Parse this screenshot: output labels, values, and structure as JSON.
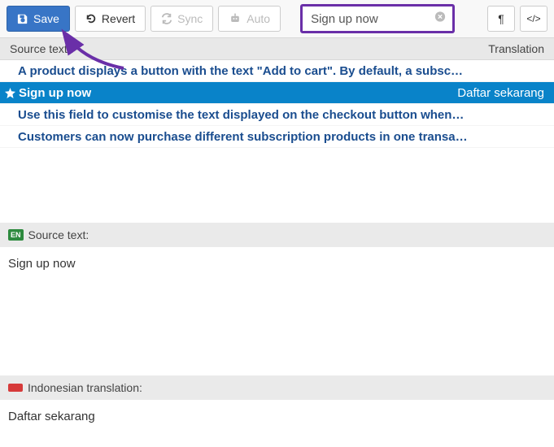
{
  "toolbar": {
    "save_label": "Save",
    "revert_label": "Revert",
    "sync_label": "Sync",
    "auto_label": "Auto",
    "search_value": "Sign up now"
  },
  "columns": {
    "source": "Source text",
    "translation": "Translation"
  },
  "rows": [
    {
      "src": "A product displays a button with the text \"Add to cart\". By default, a subsc…",
      "selected": false
    },
    {
      "src": "Sign up now",
      "translation": "Daftar sekarang",
      "selected": true
    },
    {
      "src": "Use this field to customise the text displayed on the checkout button when…",
      "selected": false
    },
    {
      "src": "Customers can now purchase different subscription products in one transa…",
      "selected": false
    }
  ],
  "source_pane": {
    "badge": "EN",
    "label": "Source text:",
    "value": "Sign up now"
  },
  "translation_pane": {
    "label": "Indonesian translation:",
    "value": "Daftar sekarang"
  }
}
